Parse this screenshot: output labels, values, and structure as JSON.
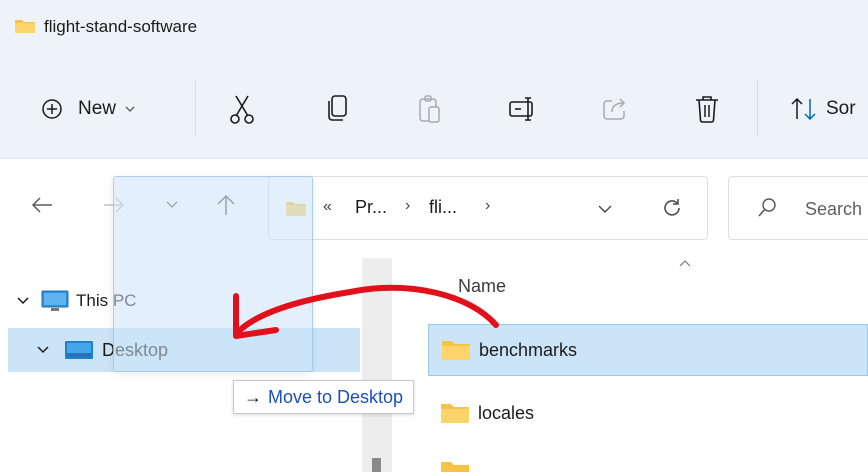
{
  "window": {
    "title": "flight-stand-software"
  },
  "toolbar": {
    "new_label": "New",
    "sort_label": "Sor",
    "icons": [
      "circle-plus-icon",
      "chevron-down-icon",
      "cut-icon",
      "copy-icon",
      "paste-icon",
      "rename-icon",
      "share-icon",
      "delete-icon",
      "sort-icon"
    ]
  },
  "nav": {
    "breadcrumb_overflow": "«",
    "crumbs": [
      "Pr...",
      "fli..."
    ],
    "search_placeholder": "Search"
  },
  "sidebar": {
    "items": [
      {
        "label": "This PC",
        "icon": "monitor-icon",
        "expanded": true
      },
      {
        "label": "Desktop",
        "icon": "desktop-icon",
        "expanded": true,
        "selected": true
      }
    ]
  },
  "content": {
    "column_name": "Name",
    "files": [
      {
        "name": "benchmarks",
        "type": "folder",
        "selected": true
      },
      {
        "name": "locales",
        "type": "folder"
      },
      {
        "name": "",
        "type": "folder"
      }
    ]
  },
  "drag": {
    "tooltip_arrow": "→",
    "tooltip": "Move to Desktop"
  },
  "colors": {
    "accent": "#0067c0",
    "selection": "#cce4f7",
    "folder": "#f8c244",
    "annotation": "#e2101a"
  }
}
